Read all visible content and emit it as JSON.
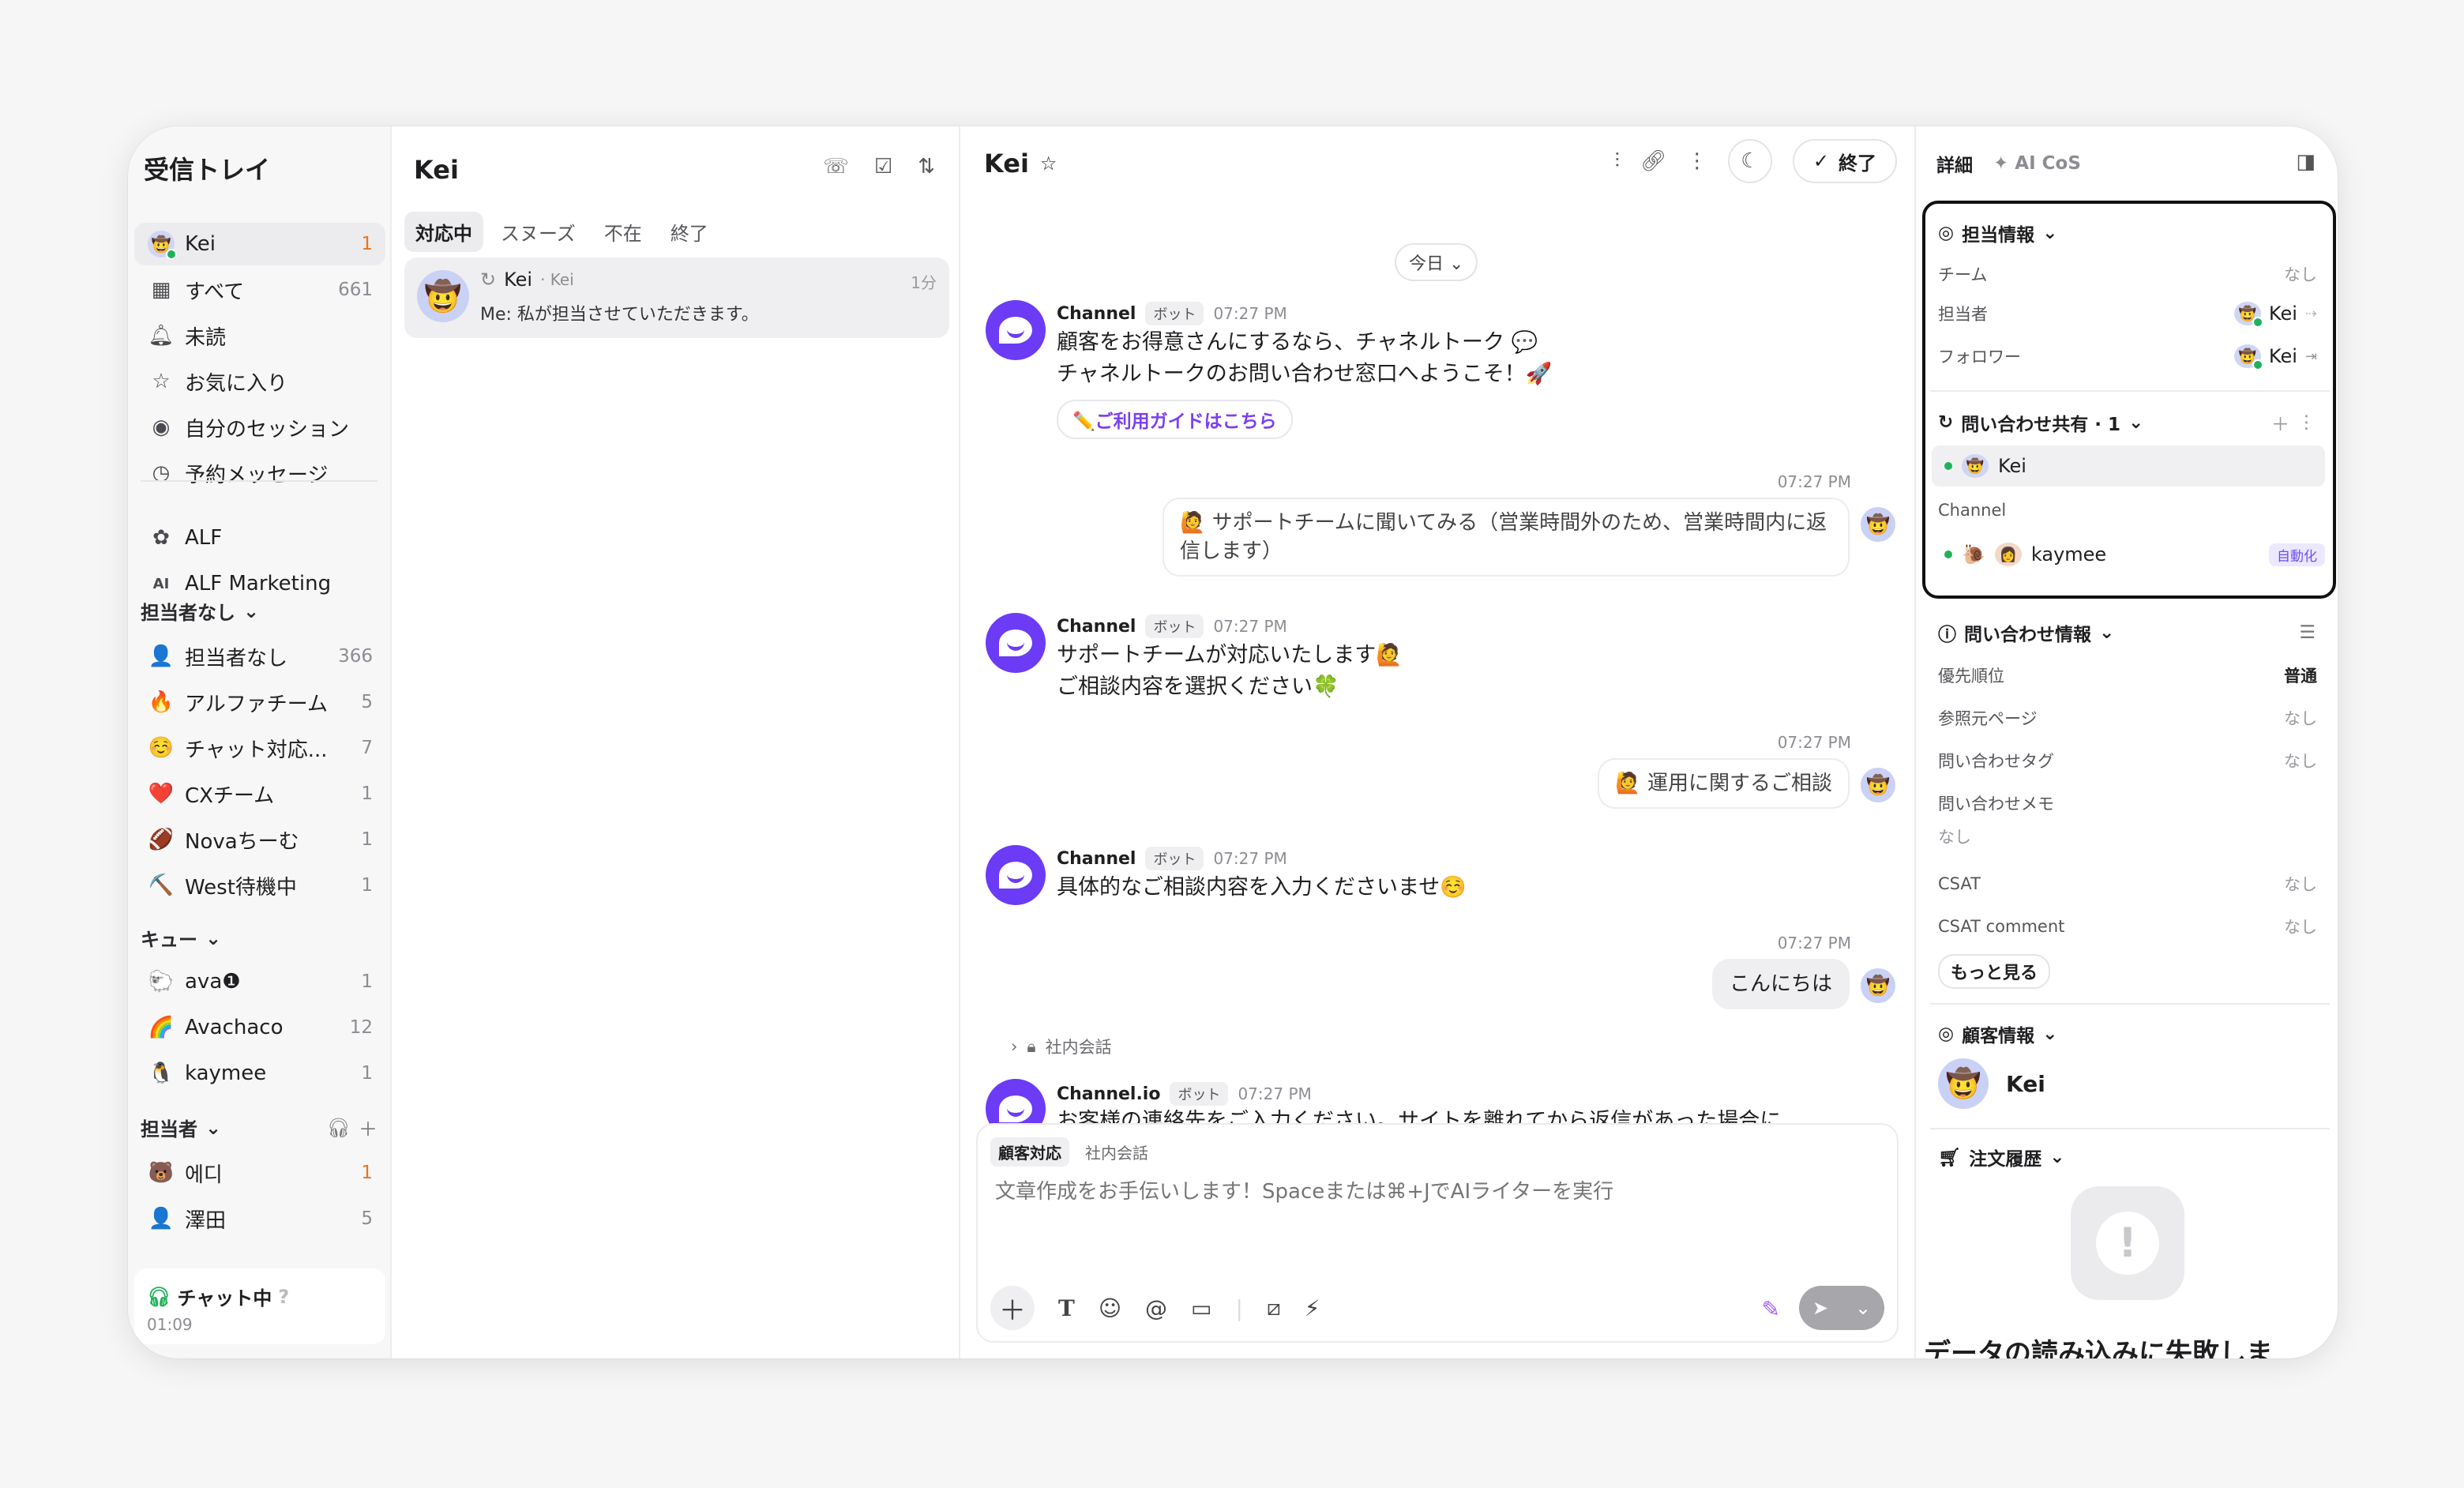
{
  "sidebar": {
    "title": "受信トレイ",
    "user": {
      "label": "Kei",
      "count": "1"
    },
    "items": [
      {
        "label": "すべて",
        "count": "661",
        "icon": "all-icon"
      },
      {
        "label": "未読",
        "count": "",
        "icon": "bell-icon"
      },
      {
        "label": "お気に入り",
        "count": "",
        "icon": "star-icon"
      },
      {
        "label": "自分のセッション",
        "count": "",
        "icon": "eye-icon"
      },
      {
        "label": "予約メッセージ",
        "count": "",
        "icon": "clock-icon"
      }
    ],
    "alf": [
      {
        "label": "ALF"
      },
      {
        "label": "ALF Marketing"
      }
    ],
    "unassigned_header": "担当者なし",
    "teams": [
      {
        "label": "担当者なし",
        "count": "366",
        "emoji": "👤"
      },
      {
        "label": "アルファチーム",
        "count": "5",
        "emoji": "🔥"
      },
      {
        "label": "チャット対応...",
        "count": "7",
        "emoji": "☺️"
      },
      {
        "label": "CXチーム",
        "count": "1",
        "emoji": "❤️"
      },
      {
        "label": "Novaちーむ",
        "count": "1",
        "emoji": "🏈"
      },
      {
        "label": "West待機中",
        "count": "1",
        "emoji": "⛏️"
      }
    ],
    "queue_header": "キュー",
    "queues": [
      {
        "label": "ava❶",
        "count": "1",
        "emoji": "🐑"
      },
      {
        "label": "Avachaco",
        "count": "12",
        "emoji": "🌈"
      },
      {
        "label": "kaymee",
        "count": "1",
        "emoji": "🐧"
      }
    ],
    "assignee_header": "担当者",
    "assignees": [
      {
        "label": "에디",
        "count": "1",
        "emoji": "🐻"
      },
      {
        "label": "澤田",
        "count": "5",
        "emoji": "👤"
      }
    ],
    "status": {
      "label": "チャット中",
      "time": "01:09"
    }
  },
  "inbox": {
    "title": "Kei",
    "tabs": [
      "対応中",
      "スヌーズ",
      "不在",
      "終了"
    ],
    "conversation": {
      "name": "Kei",
      "sub": "· Kei",
      "time": "1分",
      "message": "Me: 私が担当させていただきます。"
    }
  },
  "chat": {
    "title": "Kei",
    "end_label": "終了",
    "today": "今日",
    "messages": [
      {
        "sender": "Channel",
        "badge": "ボット",
        "time": "07:27 PM",
        "lines": [
          "顧客をお得意さんにするなら、チャネルトーク 💬",
          "チャネルトークのお問い合わせ窓口へようこそ！🚀"
        ],
        "button": "✏️ご利用ガイドはこちら"
      },
      {
        "user_time": "07:27 PM",
        "user_text": "サポートチームに聞いてみる（営業時間外のため、営業時間内に返信します）"
      },
      {
        "sender": "Channel",
        "badge": "ボット",
        "time": "07:27 PM",
        "lines": [
          "サポートチームが対応いたします🙋",
          "ご相談内容を選択ください🍀"
        ]
      },
      {
        "user_time": "07:27 PM",
        "user_text": "運用に関するご相談"
      },
      {
        "sender": "Channel",
        "badge": "ボット",
        "time": "07:27 PM",
        "lines": [
          "具体的なご相談内容を入力くださいませ☺️"
        ]
      },
      {
        "user_time": "07:27 PM",
        "user_text": "こんにちは"
      },
      {
        "internal": "社内会話"
      },
      {
        "sender": "Channel.io",
        "badge": "ボット",
        "time": "07:27 PM",
        "lines": [
          "お客様の連絡先をご入力ください。サイトを離れてから返信があった場合に"
        ]
      }
    ],
    "composer": {
      "tabs": [
        "顧客対応",
        "社内会話"
      ],
      "placeholder": "文章作成をお手伝いします！Spaceまたは⌘+JでAIライターを実行"
    }
  },
  "details": {
    "tab_details": "詳細",
    "tab_ai": "✦ AI CoS",
    "assign": {
      "header": "担当情報",
      "team_label": "チーム",
      "team_value": "なし",
      "assignee_label": "担当者",
      "assignee_value": "Kei",
      "follower_label": "フォロワー",
      "follower_value": "Kei"
    },
    "share": {
      "header": "問い合わせ共有 · 1",
      "user": "Kei",
      "channel_label": "Channel",
      "bot_name": "kaymee",
      "bot_badge": "自動化"
    },
    "info": {
      "header": "問い合わせ情報",
      "rows": [
        {
          "k": "優先順位",
          "v": "普通"
        },
        {
          "k": "参照元ページ",
          "v": "なし"
        },
        {
          "k": "問い合わせタグ",
          "v": "なし"
        }
      ],
      "memo_label": "問い合わせメモ",
      "memo_value": "なし",
      "csat_label": "CSAT",
      "csat_value": "なし",
      "csat_comment_label": "CSAT comment",
      "csat_comment_value": "なし",
      "more": "もっと見る"
    },
    "customer": {
      "header": "顧客情報",
      "name": "Kei"
    },
    "orders": {
      "header": "注文履歴",
      "error": "データの読み込みに失敗しま"
    }
  }
}
